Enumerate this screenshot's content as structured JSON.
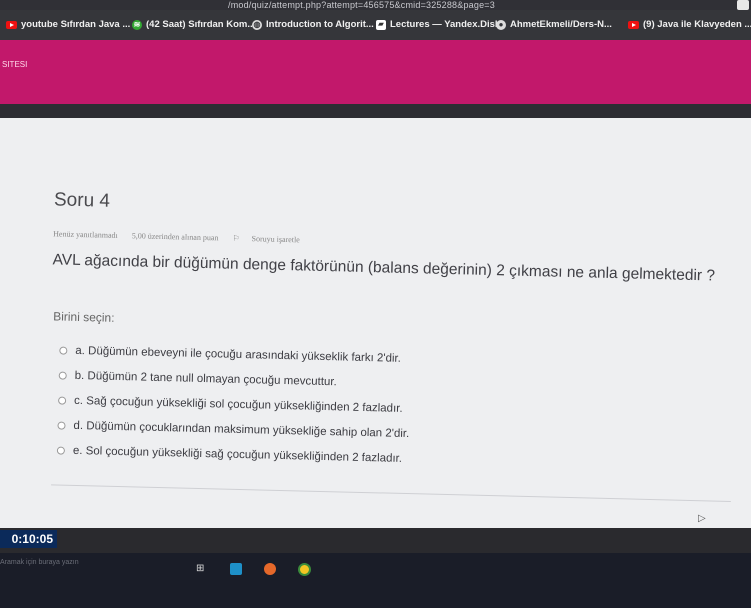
{
  "browser": {
    "url": "/mod/quiz/attempt.php?attempt=456575&cmid=325288&page=3",
    "bookmarks": [
      {
        "label": "youtube Sıfırdan Java ...",
        "icon": "youtube-icon"
      },
      {
        "label": "(42 Saat) Sıfırdan Kom...",
        "icon": "sound-wave-icon"
      },
      {
        "label": "Introduction to Algorit...",
        "icon": "globe-icon"
      },
      {
        "label": "Lectures — Yandex.Disk",
        "icon": "yandex-disk-icon"
      },
      {
        "label": "AhmetEkmeli/Ders-N...",
        "icon": "github-icon"
      },
      {
        "label": "(9) Java ile Klavyeden ...",
        "icon": "youtube-icon"
      }
    ]
  },
  "header": {
    "brand": "SITESI",
    "color": "#c2186b"
  },
  "question": {
    "title": "Soru 4",
    "status": "Henüz yanıtlanmadı",
    "points": "5,00 üzerinden alınan puan",
    "flag_label": "Soruyu işaretle",
    "text": "AVL ağacında bir düğümün denge faktörünün (balans değerinin) 2 çıkması ne anla gelmektedir ?",
    "choose_label": "Birini seçin:",
    "answers": [
      "a. Düğümün ebeveyni ile çocuğu arasındaki yükseklik farkı 2'dir.",
      "b. Düğümün 2 tane null olmayan çocuğu mevcuttur.",
      "c. Sağ çocuğun yüksekliği sol çocuğun yüksekliğinden 2 fazladır.",
      "d. Düğümün çocuklarından maksimum yüksekliğe sahip olan 2'dir.",
      "e. Sol çocuğun yüksekliği sağ çocuğun yüksekliğinden 2 fazladır."
    ]
  },
  "timer": "0:10:05",
  "taskbar": {
    "search_placeholder": "Aramak için buraya yazın"
  }
}
